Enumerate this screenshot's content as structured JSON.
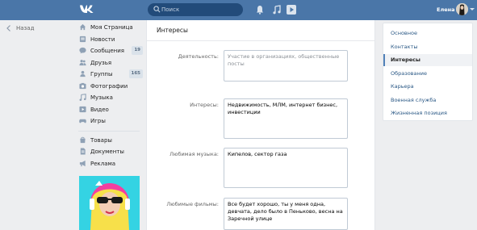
{
  "header": {
    "search_placeholder": "Поиск",
    "user_name": "Елена"
  },
  "back_label": "Назад",
  "nav": {
    "items": [
      {
        "label": "Моя Страница",
        "icon": "home-icon"
      },
      {
        "label": "Новости",
        "icon": "news-icon"
      },
      {
        "label": "Сообщения",
        "icon": "messages-icon",
        "badge": "19"
      },
      {
        "label": "Друзья",
        "icon": "friends-icon"
      },
      {
        "label": "Группы",
        "icon": "groups-icon",
        "badge": "165"
      },
      {
        "label": "Фотографии",
        "icon": "photos-icon"
      },
      {
        "label": "Музыка",
        "icon": "music-icon"
      },
      {
        "label": "Видео",
        "icon": "video-icon"
      },
      {
        "label": "Игры",
        "icon": "games-icon"
      }
    ],
    "extra": [
      {
        "label": "Товары",
        "icon": "goods-icon"
      },
      {
        "label": "Документы",
        "icon": "documents-icon"
      },
      {
        "label": "Реклама",
        "icon": "ads-icon"
      }
    ]
  },
  "main": {
    "title": "Интересы",
    "fields": [
      {
        "label": "Деятельность:",
        "value": "Участие в организациях, общественные посты",
        "is_placeholder": true
      },
      {
        "label": "Интересы:",
        "value": "Недвижимость, МЛМ, интернет бизнес, инвестиции",
        "is_placeholder": false
      },
      {
        "label": "Любимая музыка:",
        "value": "Кипелов, сектор газа",
        "is_placeholder": false
      },
      {
        "label": "Любимые фильмы:",
        "value": "Все будет хорошо, ты у меня одна, девчата, дело было в Пеньково, весна на Заречной улице",
        "is_placeholder": false
      }
    ]
  },
  "right_menu": {
    "items": [
      {
        "label": "Основное",
        "active": false
      },
      {
        "label": "Контакты",
        "active": false
      },
      {
        "label": "Интересы",
        "active": true
      },
      {
        "label": "Образование",
        "active": false
      },
      {
        "label": "Карьера",
        "active": false
      },
      {
        "label": "Военная служба",
        "active": false
      },
      {
        "label": "Жизненная позиция",
        "active": false
      }
    ]
  },
  "colors": {
    "brand": "#4a76a8",
    "link": "#2a5885",
    "background": "#edeef0"
  }
}
